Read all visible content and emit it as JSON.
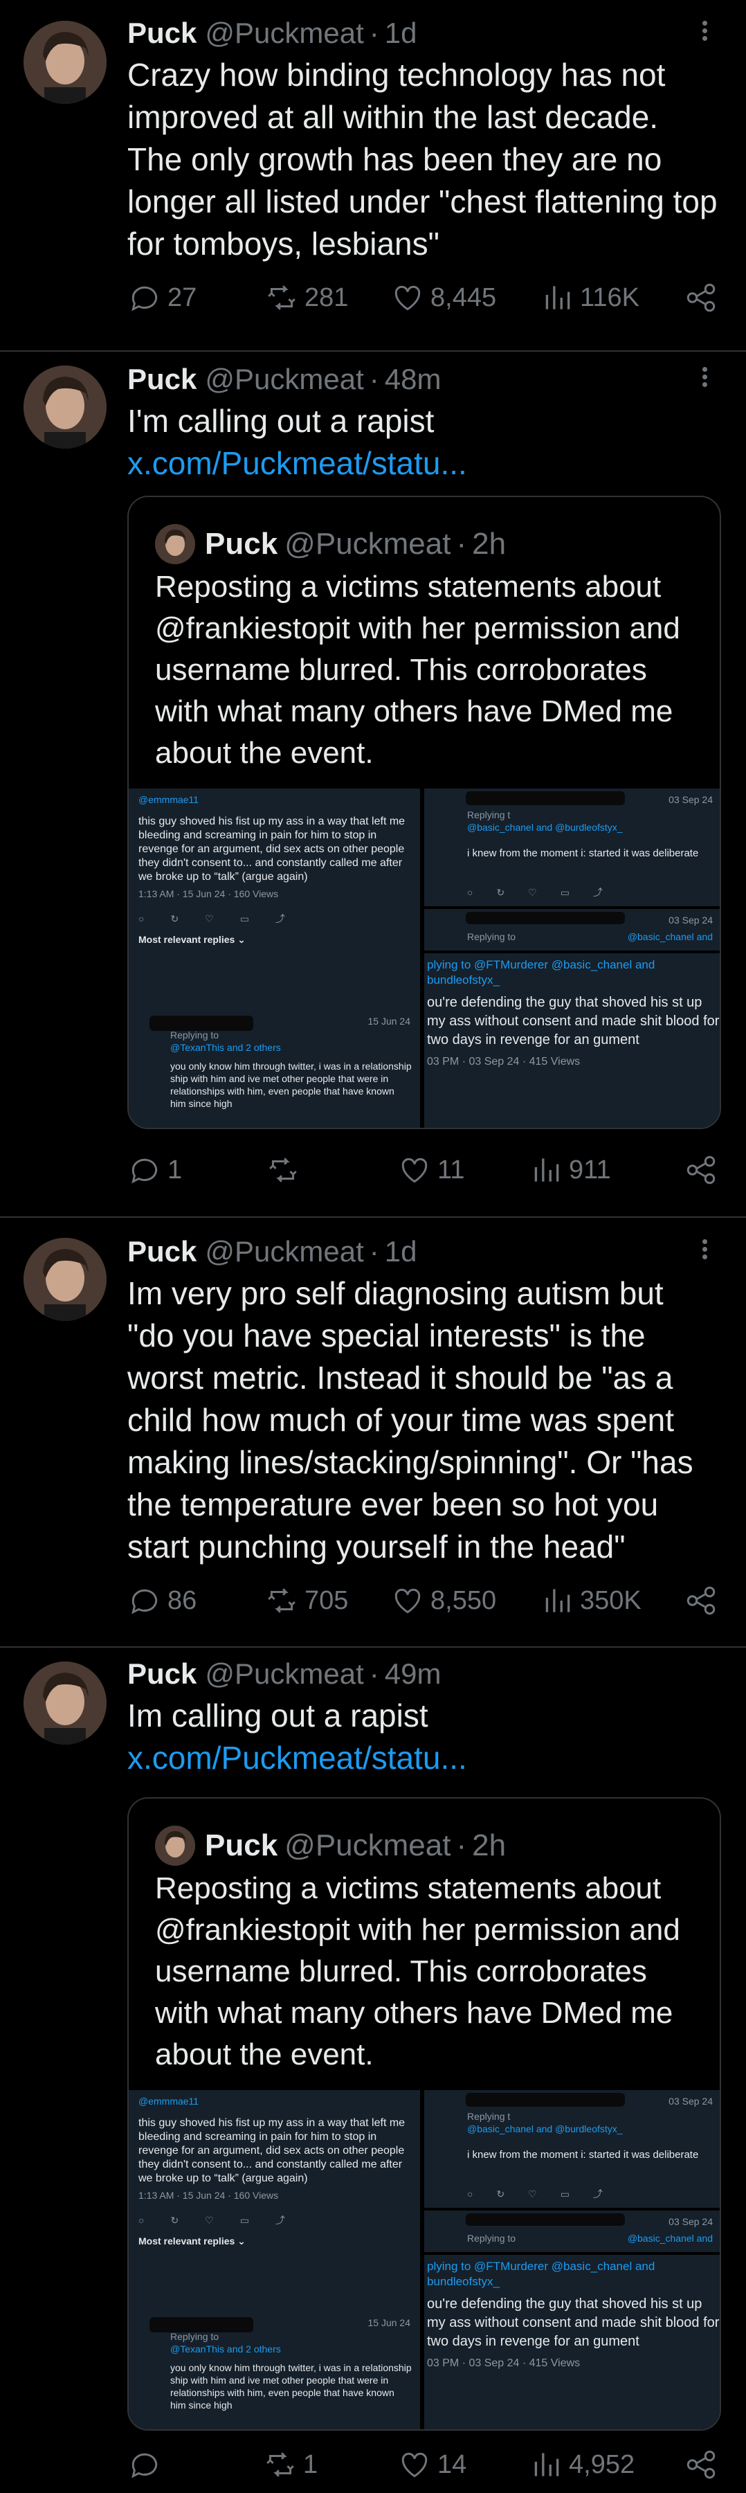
{
  "tweets": [
    {
      "name": "Puck",
      "handle": "@Puckmeat",
      "time": "1d",
      "text": "Crazy how binding technology has not improved at all within the last decade. The only growth has been they are no longer all listed under \"chest flattening top for tomboys, lesbians\"",
      "replies": "27",
      "reposts": "281",
      "likes": "8,445",
      "views": "116K"
    },
    {
      "name": "Puck",
      "handle": "@Puckmeat",
      "time": "48m",
      "text": "I'm calling out a rapist ",
      "link": "x.com/Puckmeat/statu...",
      "replies": "1",
      "reposts": "",
      "likes": "11",
      "views": "911",
      "quote": {
        "name": "Puck",
        "handle": "@Puckmeat",
        "time": "2h",
        "text": "Reposting a victims statements about @frankiestopit with her permission and username blurred. This corroborates with what many others have DMed me about the event."
      }
    },
    {
      "name": "Puck",
      "handle": "@Puckmeat",
      "time": "1d",
      "text": "Im very pro self diagnosing autism but \"do you have special interests\" is the worst metric. Instead it should be \"as a child how much of your time was spent making lines/stacking/spinning\". Or \"has the temperature ever been so hot you start punching yourself in the head\"",
      "replies": "86",
      "reposts": "705",
      "likes": "8,550",
      "views": "350K"
    },
    {
      "name": "Puck",
      "handle": "@Puckmeat",
      "time": "49m",
      "text": "Im calling out a rapist ",
      "link": "x.com/Puckmeat/statu...",
      "replies": "",
      "reposts": "1",
      "likes": "14",
      "views": "4,952",
      "quote": {
        "name": "Puck",
        "handle": "@Puckmeat",
        "time": "2h",
        "text": "Reposting a victims statements about @frankiestopit with her permission and username blurred. This corroborates with what many others have DMed me about the event."
      }
    }
  ],
  "shot": {
    "user1": "@emmmae11",
    "body1": "this guy shoved his fist up my ass in a way that left me bleeding and screaming in pain for him to stop in revenge for an argument, did sex acts on other people they didn't consent to... and constantly called me after we broke up to “talk” (argue again)",
    "meta1": "1:13 AM · 15 Jun 24 · 160 Views",
    "relevant": "Most relevant replies ⌄",
    "date2": "15 Jun 24",
    "reply2": "Replying to",
    "reply2b": "@TexanThis and 2 others",
    "body2": "you only know him through twitter, i was in a relationship ship with him and ive met other people that were in relationships with him, even people that have known him since high",
    "date3": "03 Sep 24",
    "reply3": "Replying t",
    "reply3b": "@basic_chanel and @burdleofstyx_",
    "body3": "i knew from the moment i: started it was deliberate",
    "date4": "03 Sep 24",
    "reply4": "Replying to",
    "reply4b": "@basic_chanel and",
    "reply5": "plying to @FTMurderer @basic_chanel and bundleofstyx_",
    "body5": "ou're defending the guy that shoved his st up my ass without consent and made shit blood for two days in revenge for an gument",
    "meta5": "03 PM · 03 Sep 24 · 415 Views"
  }
}
